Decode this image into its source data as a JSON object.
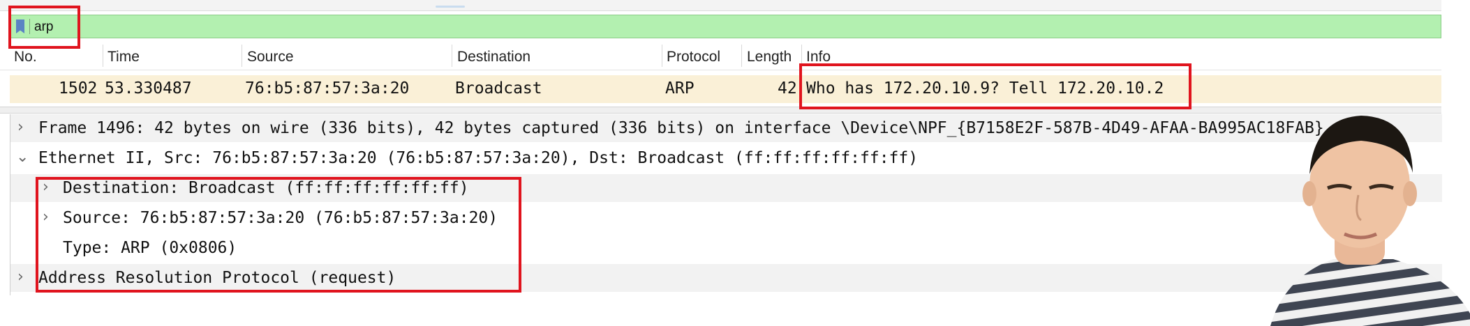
{
  "filter": {
    "value": "arp"
  },
  "columns": {
    "no": "No.",
    "time": "Time",
    "source": "Source",
    "destination": "Destination",
    "protocol": "Protocol",
    "length": "Length",
    "info": "Info"
  },
  "packet": {
    "no": "1502",
    "time": "53.330487",
    "source": "76:b5:87:57:3a:20",
    "destination": "Broadcast",
    "protocol": "ARP",
    "length": "42",
    "info": "Who has 172.20.10.9? Tell 172.20.10.2"
  },
  "details": {
    "frame": "Frame 1496: 42 bytes on wire (336 bits), 42 bytes captured (336 bits) on interface \\Device\\NPF_{B7158E2F-587B-4D49-AFAA-BA995AC18FAB}",
    "ethernet": "Ethernet II, Src: 76:b5:87:57:3a:20 (76:b5:87:57:3a:20), Dst: Broadcast (ff:ff:ff:ff:ff:ff)",
    "eth_destination": "Destination: Broadcast (ff:ff:ff:ff:ff:ff)",
    "eth_source": "Source: 76:b5:87:57:3a:20 (76:b5:87:57:3a:20)",
    "eth_type": "Type: ARP (0x0806)",
    "arp": "Address Resolution Protocol (request)"
  },
  "icons": {
    "bookmark": "bookmark-icon",
    "collapsed": "chevron-right-icon",
    "expanded": "chevron-down-icon"
  },
  "colors": {
    "filter_bg": "#b3f0b0",
    "selected_row": "#faf0d7",
    "highlight_box": "#e0141e"
  }
}
